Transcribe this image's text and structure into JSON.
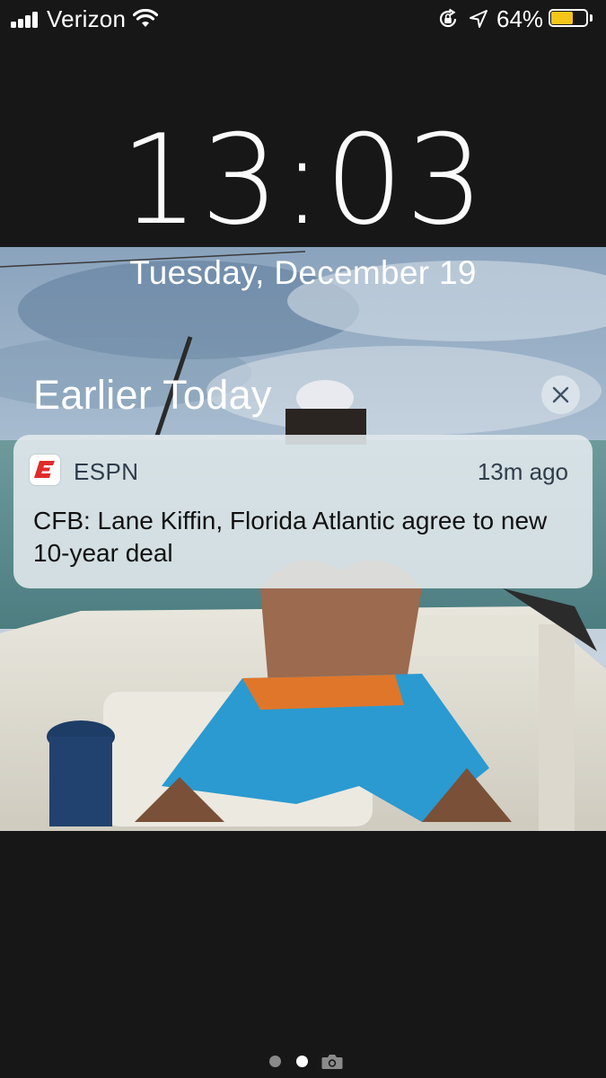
{
  "status_bar": {
    "carrier": "Verizon",
    "battery_percent": "64%",
    "battery_level": 0.64,
    "signal_bars": 4,
    "icons": [
      "signal-icon",
      "wifi-icon",
      "rotation-lock-icon",
      "location-arrow-icon",
      "battery-icon"
    ]
  },
  "lock_screen": {
    "time": "13:03",
    "date": "Tuesday, December 19",
    "section_title": "Earlier Today"
  },
  "notification": {
    "app": "ESPN",
    "time_ago": "13m ago",
    "message": "CFB: Lane Kiffin, Florida Atlantic agree to new 10-year deal",
    "icon": "espn-logo-icon"
  },
  "page_indicator": {
    "pages": 2,
    "current_page": 2,
    "trailing_icon": "camera-icon"
  },
  "colors": {
    "background": "#171717",
    "battery_fill": "#f5c518",
    "espn_red": "#e02b2b",
    "notification_bg": "#e4eaee"
  }
}
